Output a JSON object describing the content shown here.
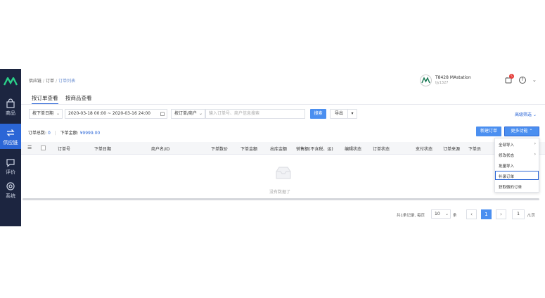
{
  "sidebar": {
    "items": [
      {
        "label": "商品",
        "icon": "bag-icon"
      },
      {
        "label": "供应链",
        "icon": "exchange-icon"
      },
      {
        "label": "评价",
        "icon": "comment-icon"
      },
      {
        "label": "系统",
        "icon": "gear-icon"
      }
    ]
  },
  "header": {
    "breadcrumb": [
      "供应链",
      "订单",
      "订单列表"
    ],
    "user_name": "T8428 MAstation",
    "user_id": "ljy1327",
    "notif_count": "5"
  },
  "tabs": [
    {
      "label": "按订单查看"
    },
    {
      "label": "按商品查看"
    }
  ],
  "filters": {
    "date_type": "按下单日期",
    "date_range": "2020-03-18 00:00 ~ 2020-03-16 24:00",
    "search_type": "按订单/商户",
    "search_placeholder": "输入订单号、商户信息搜索",
    "search_button": "搜索",
    "export_button": "导出",
    "advanced_filter": "高级筛选"
  },
  "summary": {
    "count_label": "订单总数:",
    "count_value": "0",
    "amount_label": "下单金额:",
    "amount_value": "¥9999.00"
  },
  "actions": {
    "new_order": "新建订单",
    "more": "更多功能"
  },
  "more_menu": [
    {
      "label": "全部导入",
      "submenu": true
    },
    {
      "label": "修改状态",
      "submenu": true
    },
    {
      "label": "批量导入",
      "submenu": false
    },
    {
      "label": "补录订单",
      "submenu": false
    },
    {
      "label": "获取微的订单",
      "submenu": false
    }
  ],
  "table": {
    "columns": [
      "订单号",
      "下单日期",
      "商户名/ID",
      "下单数价",
      "下单金额",
      "出库金额",
      "销售额(不含税、运)",
      "编辑状态",
      "订单状态",
      "支付状态",
      "订单来源",
      "下单员"
    ],
    "empty_text": "没有数据了"
  },
  "pagination": {
    "total_text": "共1条记录, 每页",
    "page_size": "10",
    "page_size_unit": "条",
    "current_page": "1",
    "jump_value": "1",
    "pages_text": "/1页"
  },
  "colors": {
    "sidebar_bg": "#1c2540",
    "accent": "#2b66d6",
    "button_primary": "#4b8ff0"
  }
}
